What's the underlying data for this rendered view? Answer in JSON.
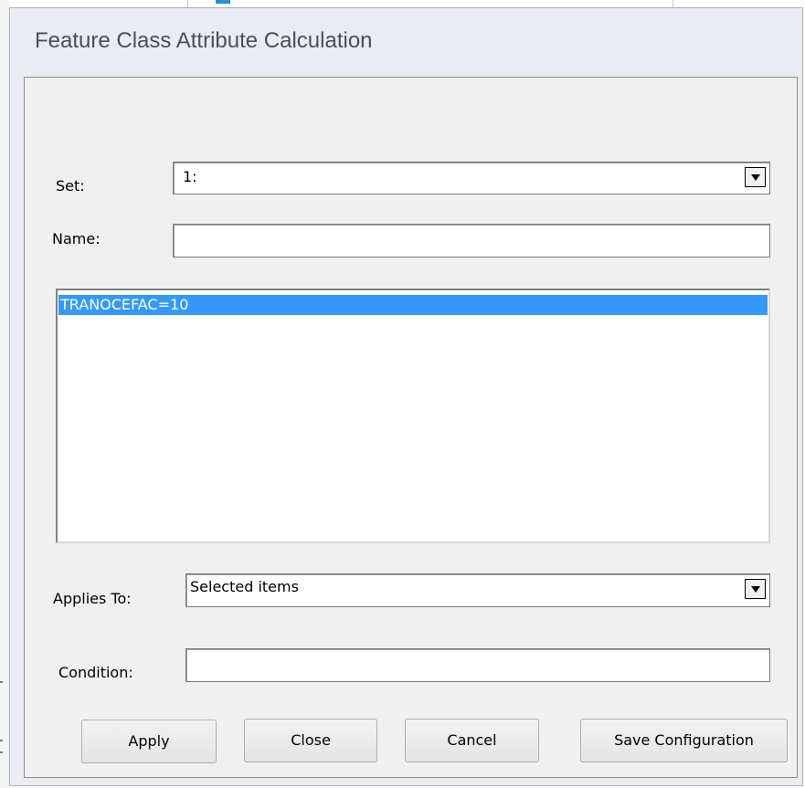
{
  "dialog": {
    "title": "Feature Class Attribute Calculation"
  },
  "form": {
    "set_label": "Set:",
    "set_value": "1:",
    "name_label": "Name:",
    "name_value": "",
    "expressions": [
      {
        "text": "TRANOCEFAC=10",
        "selected": true
      }
    ],
    "applies_to_label": "Applies To:",
    "applies_to_value": "Selected items",
    "condition_label": "Condition:",
    "condition_value": ""
  },
  "buttons": {
    "apply": "Apply",
    "close": "Close",
    "cancel": "Cancel",
    "save_configuration": "Save Configuration"
  },
  "icons": {
    "dropdown": "chevron-down-icon"
  },
  "colors": {
    "selection": "#3399ff",
    "dialog_bg": "#e9ecf1"
  }
}
